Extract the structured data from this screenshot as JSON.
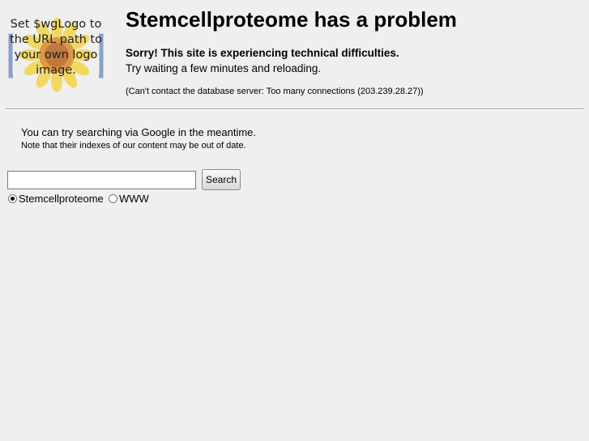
{
  "logo": {
    "text": "Set $wgLogo to the URL path to your own logo image."
  },
  "title": "Stemcellproteome has a problem",
  "error": {
    "sorry": "Sorry! This site is experiencing technical difficulties.",
    "retry": "Try waiting a few minutes and reloading.",
    "detail": "(Can't contact the database server: Too many connections (203.239.28.27))"
  },
  "google": {
    "message": "You can try searching via Google in the meantime.",
    "note": "Note that their indexes of our content may be out of date."
  },
  "search": {
    "value": "",
    "button_label": "Search",
    "options": [
      {
        "label": "Stemcellproteome",
        "checked": true
      },
      {
        "label": "WWW",
        "checked": false
      }
    ]
  }
}
